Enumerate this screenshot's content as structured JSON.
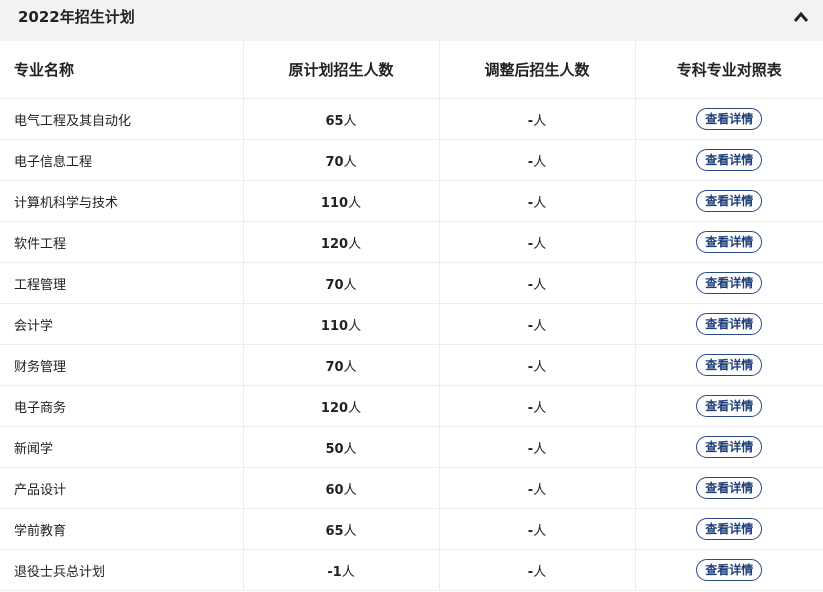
{
  "panel": {
    "title": "2022年招生计划",
    "collapse_icon": "chevron-up-icon"
  },
  "table": {
    "headers": [
      "专业名称",
      "原计划招生人数",
      "调整后招生人数",
      "专科专业对照表"
    ],
    "unit": "人",
    "button_label": "查看详情",
    "rows": [
      {
        "name": "电气工程及其自动化",
        "planned": "65",
        "adjusted": "-"
      },
      {
        "name": "电子信息工程",
        "planned": "70",
        "adjusted": "-"
      },
      {
        "name": "计算机科学与技术",
        "planned": "110",
        "adjusted": "-"
      },
      {
        "name": "软件工程",
        "planned": "120",
        "adjusted": "-"
      },
      {
        "name": "工程管理",
        "planned": "70",
        "adjusted": "-"
      },
      {
        "name": "会计学",
        "planned": "110",
        "adjusted": "-"
      },
      {
        "name": "财务管理",
        "planned": "70",
        "adjusted": "-"
      },
      {
        "name": "电子商务",
        "planned": "120",
        "adjusted": "-"
      },
      {
        "name": "新闻学",
        "planned": "50",
        "adjusted": "-"
      },
      {
        "name": "产品设计",
        "planned": "60",
        "adjusted": "-"
      },
      {
        "name": "学前教育",
        "planned": "65",
        "adjusted": "-"
      },
      {
        "name": "退役士兵总计划",
        "planned": "-1",
        "adjusted": "-"
      }
    ]
  }
}
